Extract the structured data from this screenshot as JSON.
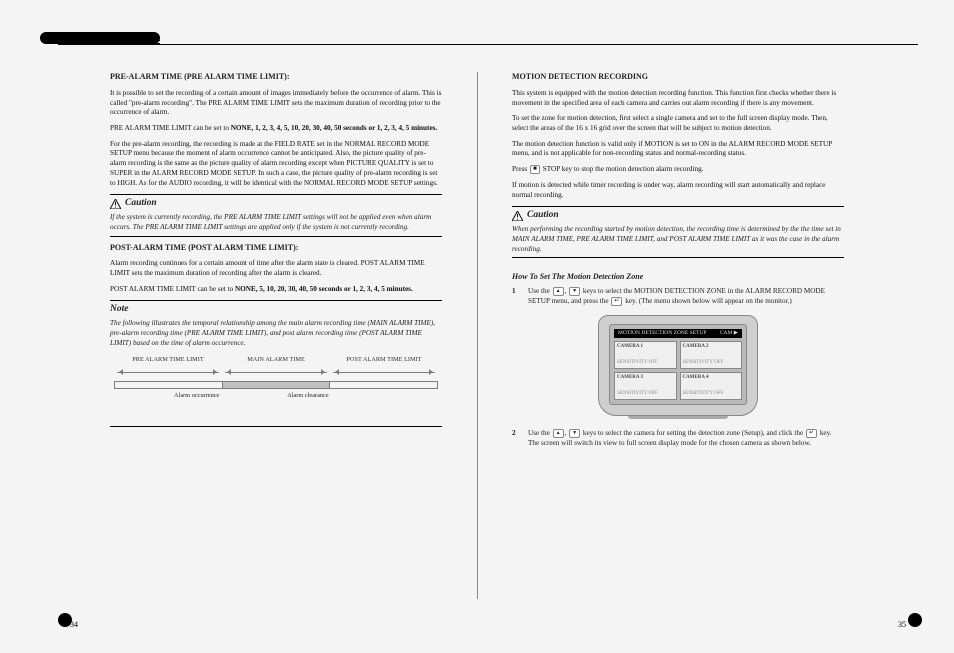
{
  "leftPageNum": "34",
  "rightPageNum": "35",
  "left": {
    "title1": "PRE-ALARM TIME (PRE ALARM TIME LIMIT):",
    "p1": "It is possible to set the recording of a certain amount of images immediately before the occurrence of alarm. This is called \"pre-alarm recording\". The PRE ALARM TIME LIMIT sets the maximum duration of recording prior to the occurrence of alarm.",
    "p2_prefix": "PRE ALARM TIME LIMIT can be set to ",
    "p2_bold": "NONE, 1, 2, 3, 4, 5, 10, 20, 30, 40, 50 seconds or 1, 2, 3, 4, 5 minutes.",
    "p3": "For the pre-alarm recording, the recording is made at the FIELD RATE set in the NORMAL RECORD MODE SETUP menu because the moment of alarm occurrence cannot be anticipated. Also, the picture quality of pre-alarm recording is the same as the picture quality of alarm recording except when PICTURE QUALITY is set to SUPER in the ALARM RECORD MODE SETUP. In such a case, the picture quality of pre-alarm recording is set to HIGH. As for the AUDIO recording, it will be identical with the NORMAL RECORD MODE SETUP settings.",
    "caution1_head": "Caution",
    "caution1_body": "If the system is currently recording, the PRE ALARM TIME LIMIT settings will not be applied even when alarm occurs. The PRE ALARM TIME LIMIT settings are applied only if the system is not currently recording.",
    "title2": "POST-ALARM TIME (POST ALARM TIME LIMIT):",
    "p4": "Alarm recording continues for a certain amount of time after the alarm state is cleared. POST ALARM TIME LIMIT sets the maximum duration of recording after the alarm is cleared.",
    "p5_prefix": "POST ALARM TIME LIMIT can be set to ",
    "p5_bold": "NONE, 5, 10, 20, 30, 40, 50 seconds or 1, 2, 3, 4, 5 minutes.",
    "note_head": "Note",
    "note_body": "The following illustrates the temporal relationship among the main alarm recording time (MAIN ALARM TIME), pre-alarm recording time (PRE ALARM TIME LIMIT), and post alarm recording time (POST ALARM TIME LIMIT) based on the time of alarm occurrence.",
    "tl_top": [
      "PRE ALARM TIME LIMIT",
      "MAIN ALARM TIME",
      "POST ALARM TIME LIMIT"
    ],
    "tl_bot": [
      "Alarm occurrence",
      "Alarm clearance"
    ]
  },
  "right": {
    "title1": "MOTION DETECTION RECORDING",
    "p1": "This system is equipped with the motion detection recording function. This function first checks whether there is movement in the specified area of each camera and carries out alarm recording if there is any movement.",
    "p2": "To set the zone for motion detection, first select a single camera and set to the full screen display mode. Then, select the areas of the 16 x 16 grid over the screen that will be subject to motion detection.",
    "p3": "The motion detection function is valid only if MOTION is set to ON in the ALARM RECORD MODE SETUP menu, and is not applicable for non-recording status and normal-recording status.",
    "p4_prefix": "Press ",
    "p4_mid": " STOP key to stop the motion detection alarm recording.",
    "p5": "If motion is detected while timer recording is under way, alarm recording will start automatically and replace normal recording.",
    "caution_head": "Caution",
    "caution_body": "When performing the recording started by motion detection, the recording time is determined by the the time set in MAIN ALARM TIME, PRE ALARM TIME LIMIT, and POST ALARM TIME LIMIT as it was the case in the alarm recording.",
    "subhead": "How To Set The Motion Detection Zone",
    "step1_a": "Use the ",
    "step1_b": ", ",
    "step1_c": " keys to select the MOTION DETECTION ZONE in the ALARM RECORD MODE SETUP menu, and press the ",
    "step1_d": " key. (The menu shown below will appear on the monitor.)",
    "tv": {
      "hd_l": "MOTION DETECTION ZONE SETUP",
      "hd_r": "CAM ▶",
      "cams": [
        {
          "l": "CAMERA 1",
          "s": "SENSITIVITY  OFF"
        },
        {
          "l": "CAMERA 2",
          "s": "SENSITIVITY  OFF"
        },
        {
          "l": "CAMERA 3",
          "s": "SENSITIVITY  OFF"
        },
        {
          "l": "CAMERA 4",
          "s": "SENSITIVITY  OFF"
        }
      ]
    },
    "step2_a": "Use the ",
    "step2_b": ", ",
    "step2_c": " keys to select the camera for setting the detection zone (Setup), and click the ",
    "step2_d": " key. The screen will switch its view to full screen display mode for the chosen camera as shown below."
  }
}
